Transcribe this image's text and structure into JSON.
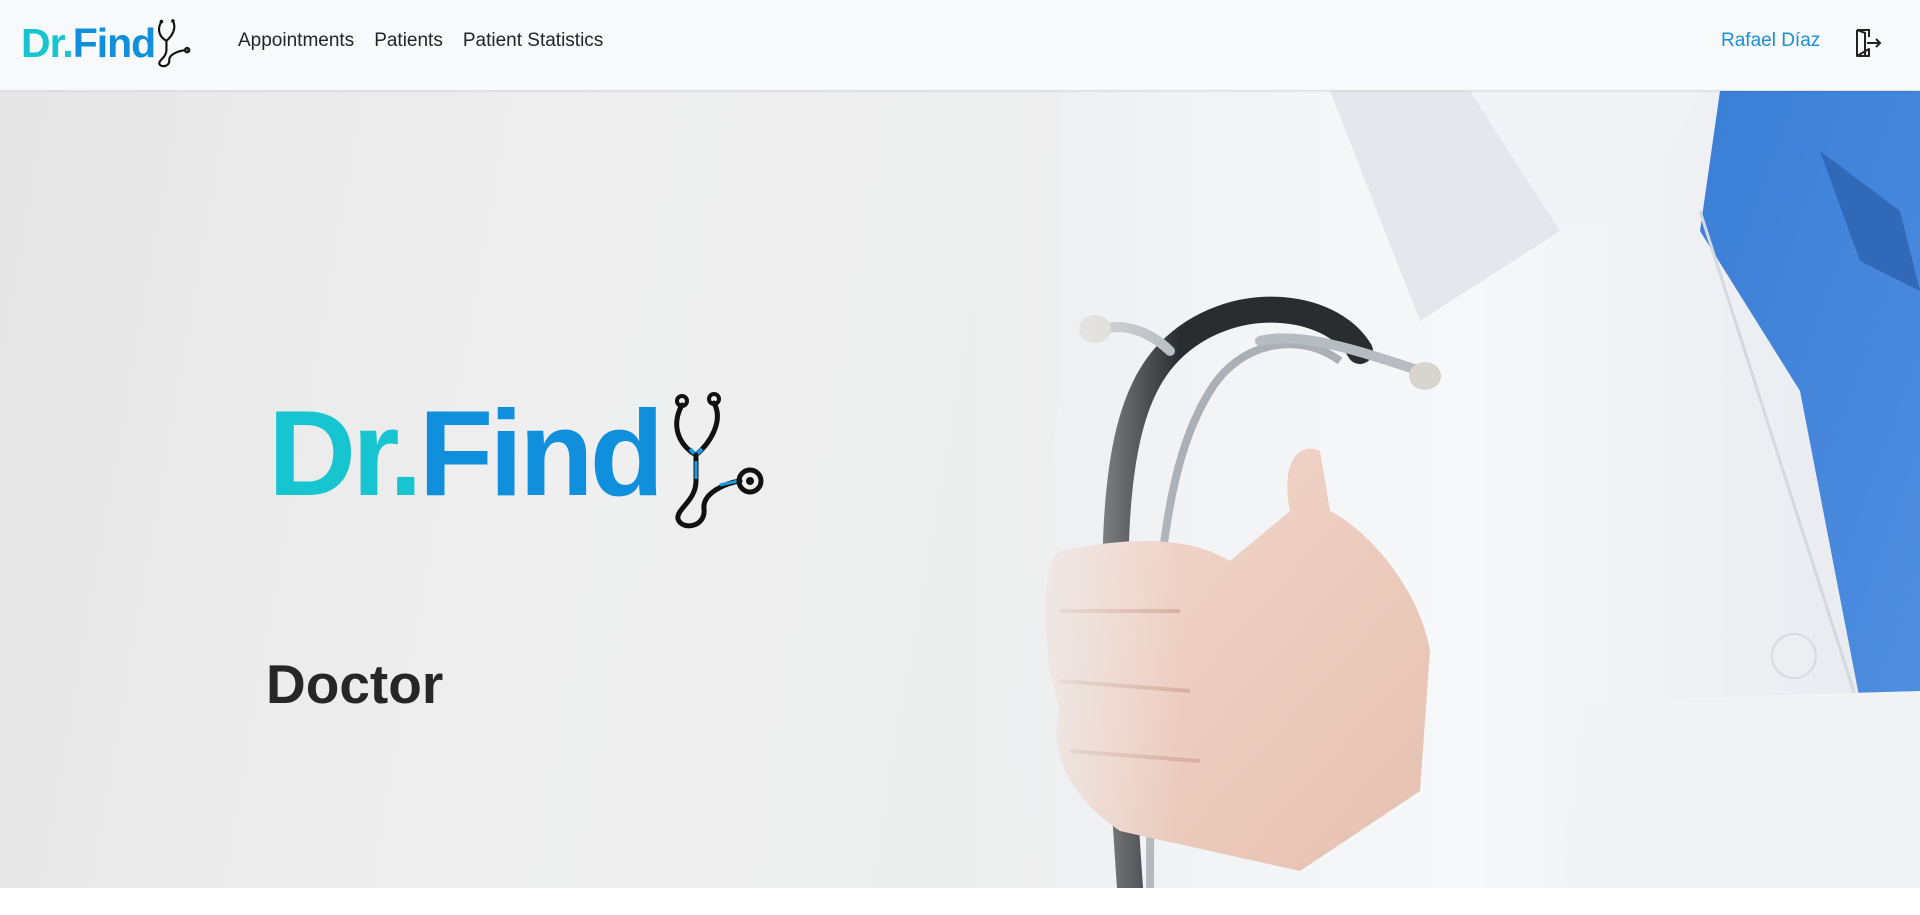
{
  "brand": {
    "dr": "Dr.",
    "find": "Find",
    "colors": {
      "dr": "#17c5d0",
      "find": "#0f8fdc"
    },
    "icon": "stethoscope-icon"
  },
  "nav": {
    "links": [
      {
        "label": "Appointments"
      },
      {
        "label": "Patients"
      },
      {
        "label": "Patient Statistics"
      }
    ],
    "user_name": "Rafael Díaz",
    "logout_icon": "logout-icon"
  },
  "hero": {
    "logo_dr": "Dr.",
    "logo_find": "Find",
    "role": "Doctor",
    "image": "doctor-with-stethoscope-photo"
  }
}
